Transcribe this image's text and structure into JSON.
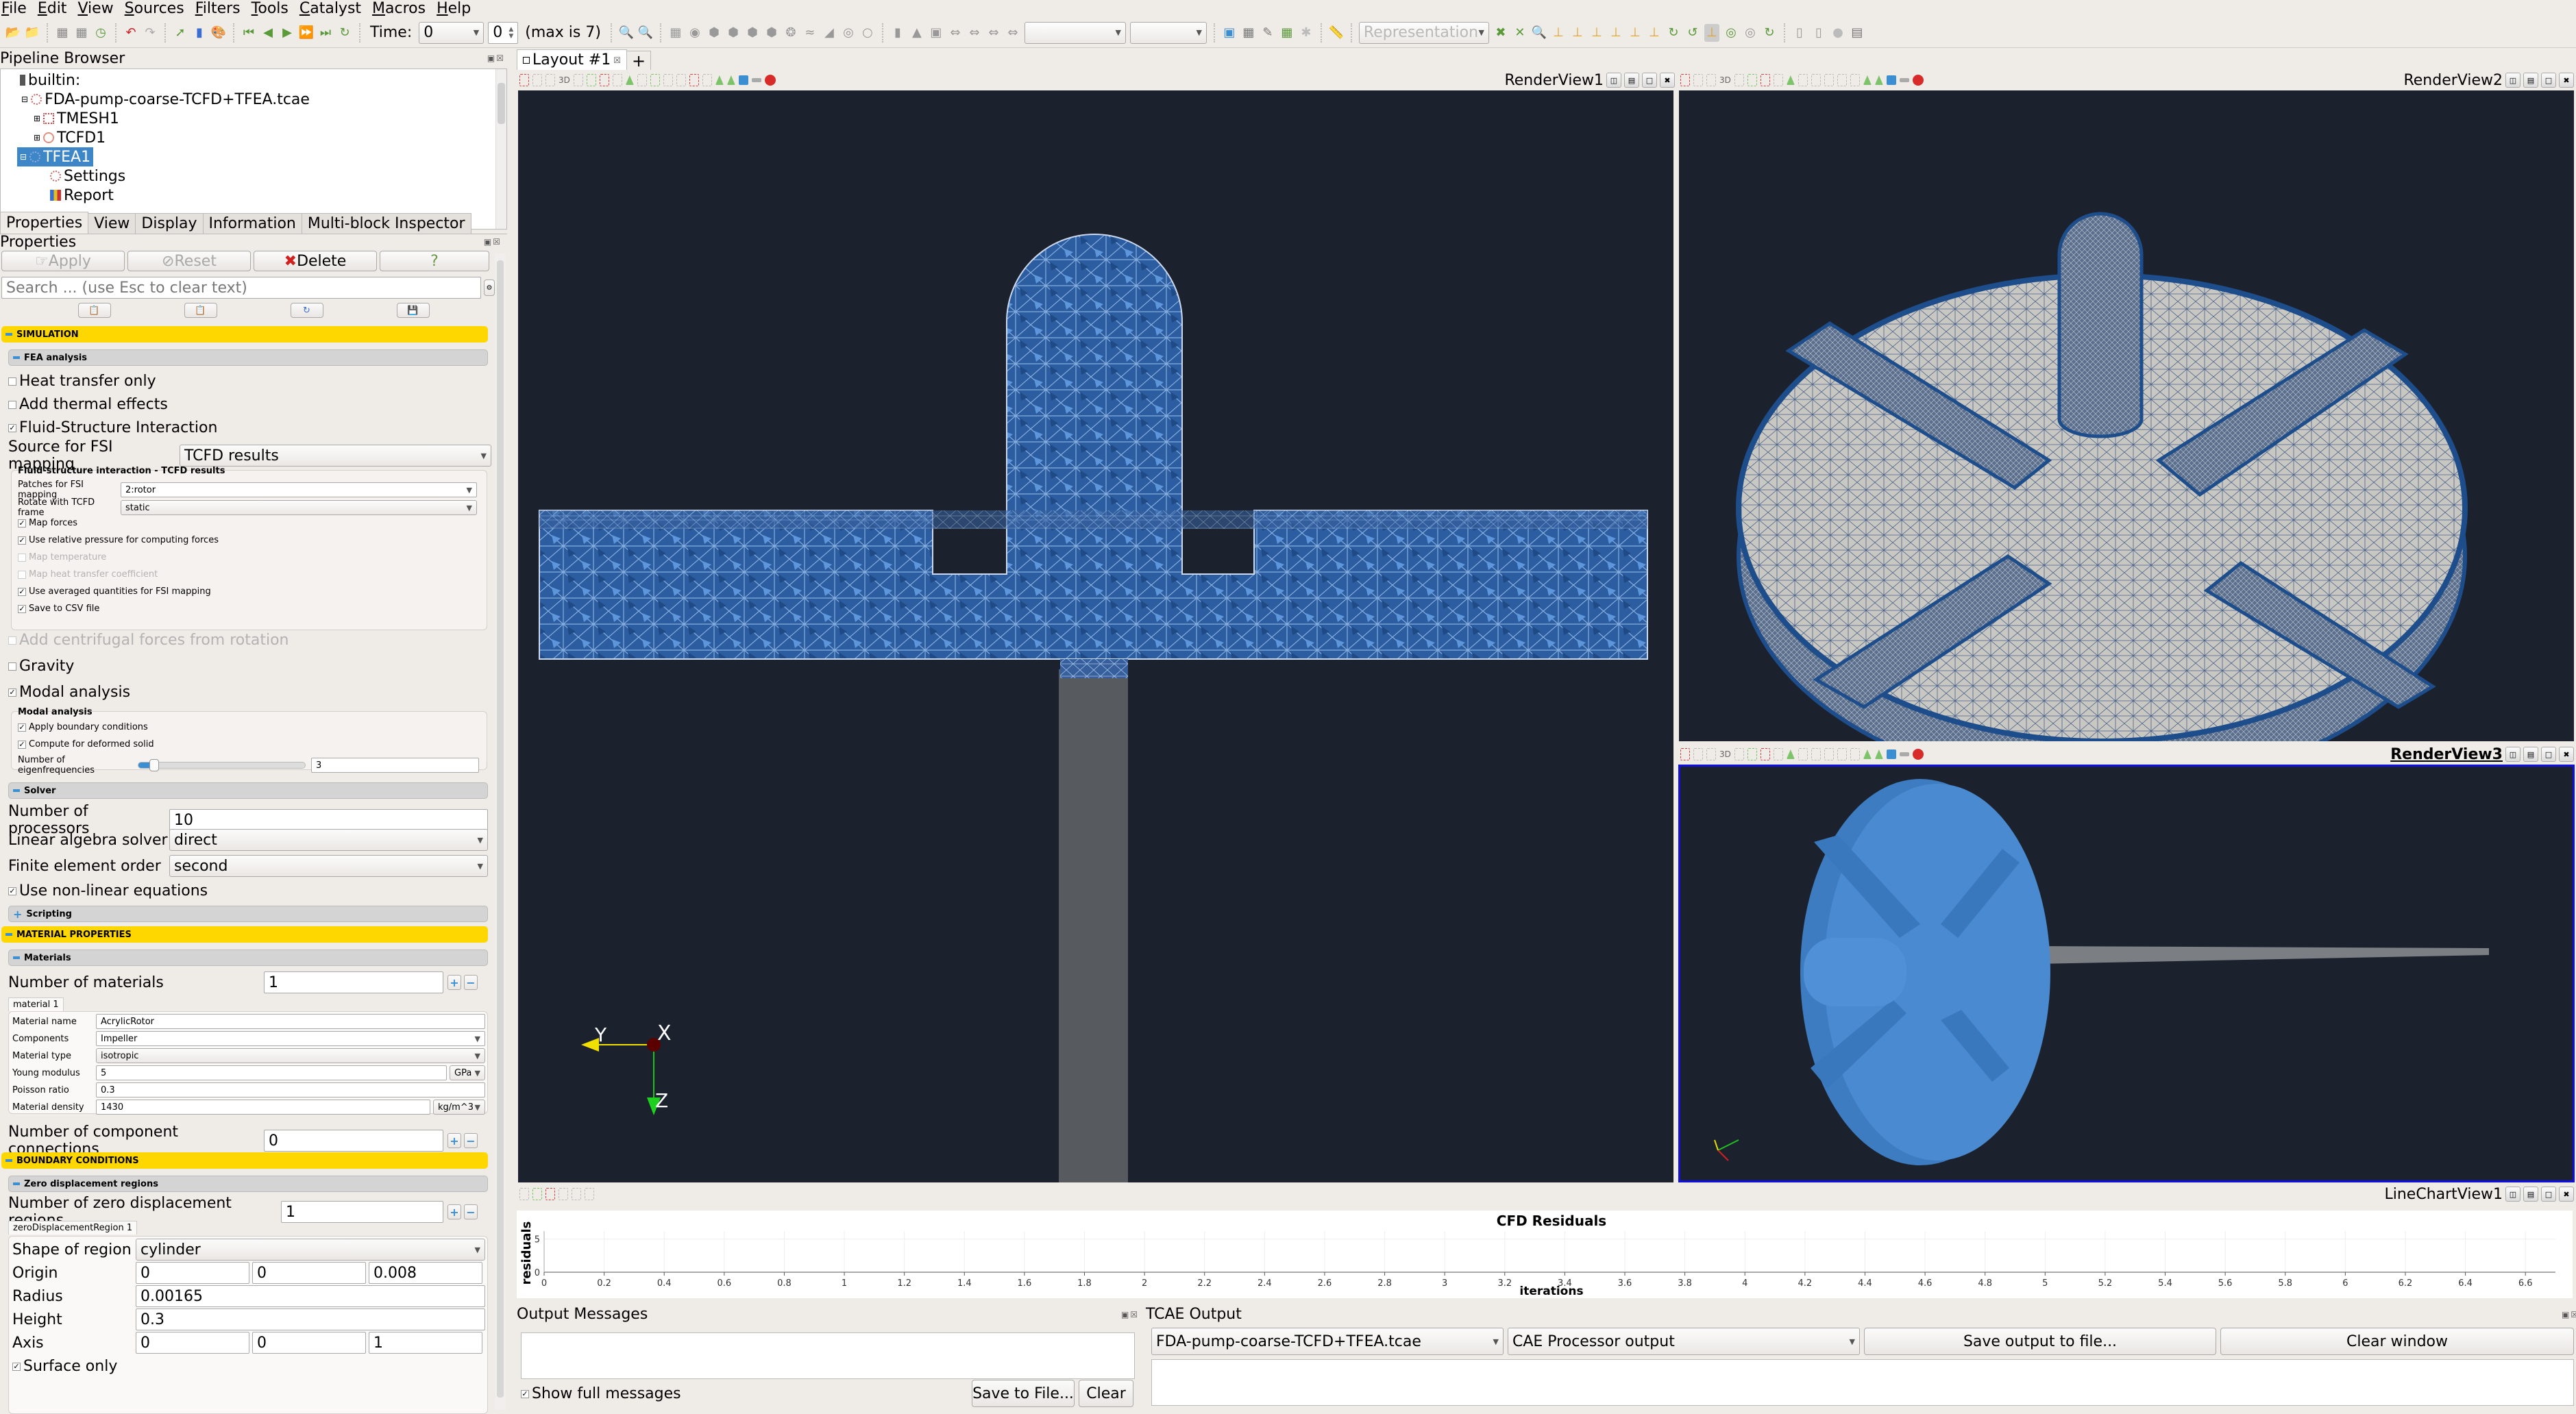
{
  "menu": [
    "File",
    "Edit",
    "View",
    "Sources",
    "Filters",
    "Tools",
    "Catalyst",
    "Macros",
    "Help"
  ],
  "toolbar": {
    "time_label": "Time:",
    "time_value": "0",
    "timestep_value": "0",
    "max_label": "(max is 7)",
    "representation_placeholder": "Representation"
  },
  "pipeline": {
    "title": "Pipeline Browser",
    "items": [
      {
        "label": "builtin:",
        "icon": "server-icon"
      },
      {
        "label": "FDA-pump-coarse-TCFD+TFEA.tcae",
        "icon": "tcae-file-icon"
      },
      {
        "label": "TMESH1",
        "icon": "mesh-icon"
      },
      {
        "label": "TCFD1",
        "icon": "cfd-icon"
      },
      {
        "label": "TFEA1",
        "icon": "fea-icon",
        "selected": true
      },
      {
        "label": "Settings",
        "icon": "settings-icon"
      },
      {
        "label": "Report",
        "icon": "report-chart-icon"
      }
    ]
  },
  "tabs": [
    "Properties",
    "View",
    "Display",
    "Information",
    "Multi-block Inspector"
  ],
  "properties": {
    "title": "Properties",
    "apply": "Apply",
    "reset": "Reset",
    "delete": "Delete",
    "help": "?",
    "search_placeholder": "Search ... (use Esc to clear text)",
    "simulation_header": "SIMULATION",
    "fea_header": "FEA analysis",
    "heat_transfer_only": {
      "label": "Heat transfer only",
      "checked": false
    },
    "add_thermal_effects": {
      "label": "Add thermal effects",
      "checked": false
    },
    "fsi": {
      "label": "Fluid-Structure Interaction",
      "checked": true
    },
    "fsi_source_label": "Source for FSI mapping",
    "fsi_source_value": "TCFD results",
    "fsi_group_title": "Fluid-structure interaction - TCFD results",
    "patches_label": "Patches for FSI mapping",
    "patches_value": "2:rotor",
    "rotate_label": "Rotate with TCFD frame",
    "rotate_value": "static",
    "fsi_checks": [
      {
        "label": "Map forces",
        "checked": true,
        "enabled": true
      },
      {
        "label": "Use relative pressure for computing forces",
        "checked": true,
        "enabled": true
      },
      {
        "label": "Map temperature",
        "checked": false,
        "enabled": false
      },
      {
        "label": "Map heat transfer coefficient",
        "checked": false,
        "enabled": false
      },
      {
        "label": "Use averaged quantities for FSI mapping",
        "checked": true,
        "enabled": true
      },
      {
        "label": "Save to CSV file",
        "checked": true,
        "enabled": true
      }
    ],
    "centrifugal": {
      "label": "Add centrifugal forces from rotation",
      "checked": false,
      "enabled": false
    },
    "gravity": {
      "label": "Gravity",
      "checked": false
    },
    "modal": {
      "label": "Modal analysis",
      "checked": true
    },
    "modal_group_title": "Modal analysis",
    "modal_checks": [
      {
        "label": "Apply boundary conditions",
        "checked": true
      },
      {
        "label": "Compute for deformed solid",
        "checked": true
      }
    ],
    "eigen_label": "Number of eigenfrequencies",
    "eigen_value": "3",
    "eigen_slider_fraction": 0.04,
    "solver_header": "Solver",
    "processors_label": "Number of processors",
    "processors_value": "10",
    "linear_solver_label": "Linear algebra solver",
    "linear_solver_value": "direct",
    "fe_order_label": "Finite element order",
    "fe_order_value": "second",
    "nonlinear": {
      "label": "Use non-linear equations",
      "checked": true
    },
    "scripting_header": "Scripting",
    "material_header": "MATERIAL PROPERTIES",
    "materials_header": "Materials",
    "num_materials_label": "Number of materials",
    "num_materials_value": "1",
    "material_tab": "material 1",
    "material_name_label": "Material name",
    "material_name_value": "AcrylicRotor",
    "components_label": "Components",
    "components_value": "Impeller",
    "material_type_label": "Material type",
    "material_type_value": "isotropic",
    "young_label": "Young modulus",
    "young_value": "5",
    "young_unit": "GPa",
    "poisson_label": "Poisson ratio",
    "poisson_value": "0.3",
    "density_label": "Material density",
    "density_value": "1430",
    "density_unit": "kg/m^3",
    "connections_label": "Number of component connections",
    "connections_value": "0",
    "boundary_header": "BOUNDARY CONDITIONS",
    "zero_disp_header": "Zero displacement regions",
    "num_zero_disp_label": "Number of zero displacement regions",
    "num_zero_disp_value": "1",
    "zero_disp_tab": "zeroDisplacementRegion 1",
    "shape_label": "Shape of region",
    "shape_value": "cylinder",
    "origin_label": "Origin",
    "origin": [
      "0",
      "0",
      "0.008"
    ],
    "radius_label": "Radius",
    "radius_value": "0.00165",
    "height_label": "Height",
    "height_value": "0.3",
    "axis_label": "Axis",
    "axis": [
      "0",
      "0",
      "1"
    ],
    "surface_only": {
      "label": "Surface only",
      "checked": true
    }
  },
  "layout": {
    "tab_label": "Layout #1",
    "add_tab": "+",
    "views": [
      {
        "name": "RenderView1",
        "active": false
      },
      {
        "name": "RenderView2",
        "active": false
      },
      {
        "name": "RenderView3",
        "active": true
      },
      {
        "name": "LineChartView1",
        "active": false
      }
    ],
    "three_d_label": "3D",
    "axes_labels": {
      "x": "X",
      "y": "Y",
      "z": "Z"
    }
  },
  "colors": {
    "view_bg": "#1b222d",
    "mesh_blue": "#3c6fb0",
    "impeller_blue": "#4a86c8",
    "section_yellow": "#ffd700",
    "selection_blue": "#3d87c8",
    "active_view_border": "#1010e0"
  },
  "chart_data": {
    "type": "line",
    "title": "CFD Residuals",
    "xlabel": "iterations",
    "ylabel": "residuals",
    "x_ticks": [
      "0",
      "0.2",
      "0.4",
      "0.6",
      "0.8",
      "1",
      "1.2",
      "1.4",
      "1.6",
      "1.8",
      "2",
      "2.2",
      "2.4",
      "2.6",
      "2.8",
      "3",
      "3.2",
      "3.4",
      "3.6",
      "3.8",
      "4",
      "4.2",
      "4.4",
      "4.6",
      "4.8",
      "5",
      "5.2",
      "5.4",
      "5.6",
      "5.8",
      "6",
      "6.2",
      "6.4",
      "6.6"
    ],
    "y_ticks": [
      "0",
      "5"
    ],
    "xlim": [
      0,
      6.7
    ],
    "ylim": [
      0,
      6.2
    ],
    "grid": true,
    "series": []
  },
  "output_messages": {
    "title": "Output Messages",
    "show_full": {
      "label": "Show full messages",
      "checked": true
    },
    "save": "Save to File...",
    "clear": "Clear"
  },
  "tcae_output": {
    "title": "TCAE Output",
    "file_value": "FDA-pump-coarse-TCFD+TFEA.tcae",
    "source_value": "CAE Processor output",
    "save": "Save output to file...",
    "clear": "Clear window"
  }
}
